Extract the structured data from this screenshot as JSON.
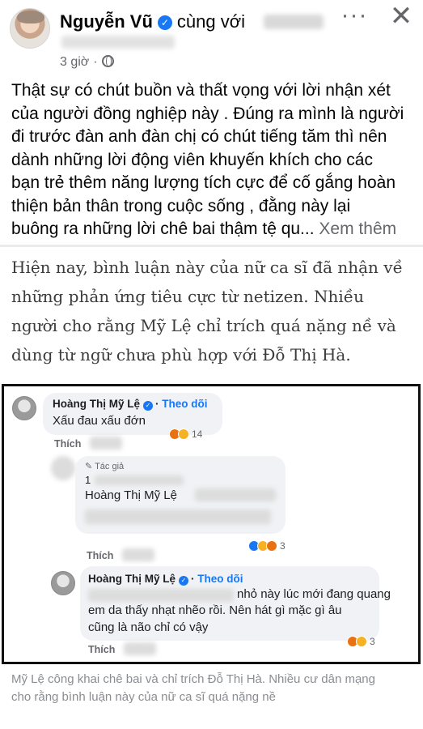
{
  "post": {
    "author": "Nguyễn Vũ",
    "with_text": "cùng với",
    "time": "3 giờ",
    "more_label": "···",
    "close_label": "✕",
    "body_lines": [
      "Thật sự có chút buồn và thất vọng với lời nhận xét",
      "của người đồng nghiệp này . Đúng ra mình là người",
      "đi trước đàn anh đàn chị có chút tiếng tăm thì nên",
      "dành những lời động viên khuyến khích cho các",
      "bạn trẻ thêm năng lượng tích cực để cố gắng hoàn",
      "thiện bản thân trong cuộc sống , đằng này lại",
      "buông ra những lời chê bai thậm tệ qu..."
    ],
    "see_more": "Xem thêm"
  },
  "article": {
    "lines": [
      "Hiện nay, bình luận này của nữ ca sĩ đã nhận về",
      "những phản ứng tiêu cực từ netizen. Nhiều",
      "người cho rằng Mỹ Lệ chỉ trích quá nặng nề và",
      "dùng từ ngữ chưa phù hợp với Đỗ Thị Hà."
    ]
  },
  "comments": {
    "c1": {
      "name": "Hoàng Thị Mỹ Lệ",
      "follow": "Theo dõi",
      "text": "Xấu đau xấu đớn",
      "like": "Thích",
      "count": "14"
    },
    "reply": {
      "author_tag": "Tác giả",
      "line1": "1",
      "mention": "Hoàng Thị Mỹ Lệ",
      "like": "Thích",
      "count": "3"
    },
    "c2": {
      "name": "Hoàng Thị Mỹ Lệ",
      "follow": "Theo dõi",
      "line1": "nhỏ này lúc mới đang quang",
      "line2": "em da thấy nhạt nhẽo rồi. Nên hát gì mặc gì âu",
      "line3": "cũng là não chỉ có vậy",
      "like": "Thích",
      "count": "3"
    }
  },
  "caption": {
    "lines": [
      "Mỹ Lệ công khai chê bai và chỉ trích Đỗ Thị Hà. Nhiều cư dân mạng",
      "cho rằng bình luận này của nữ ca sĩ quá nặng nề"
    ]
  }
}
